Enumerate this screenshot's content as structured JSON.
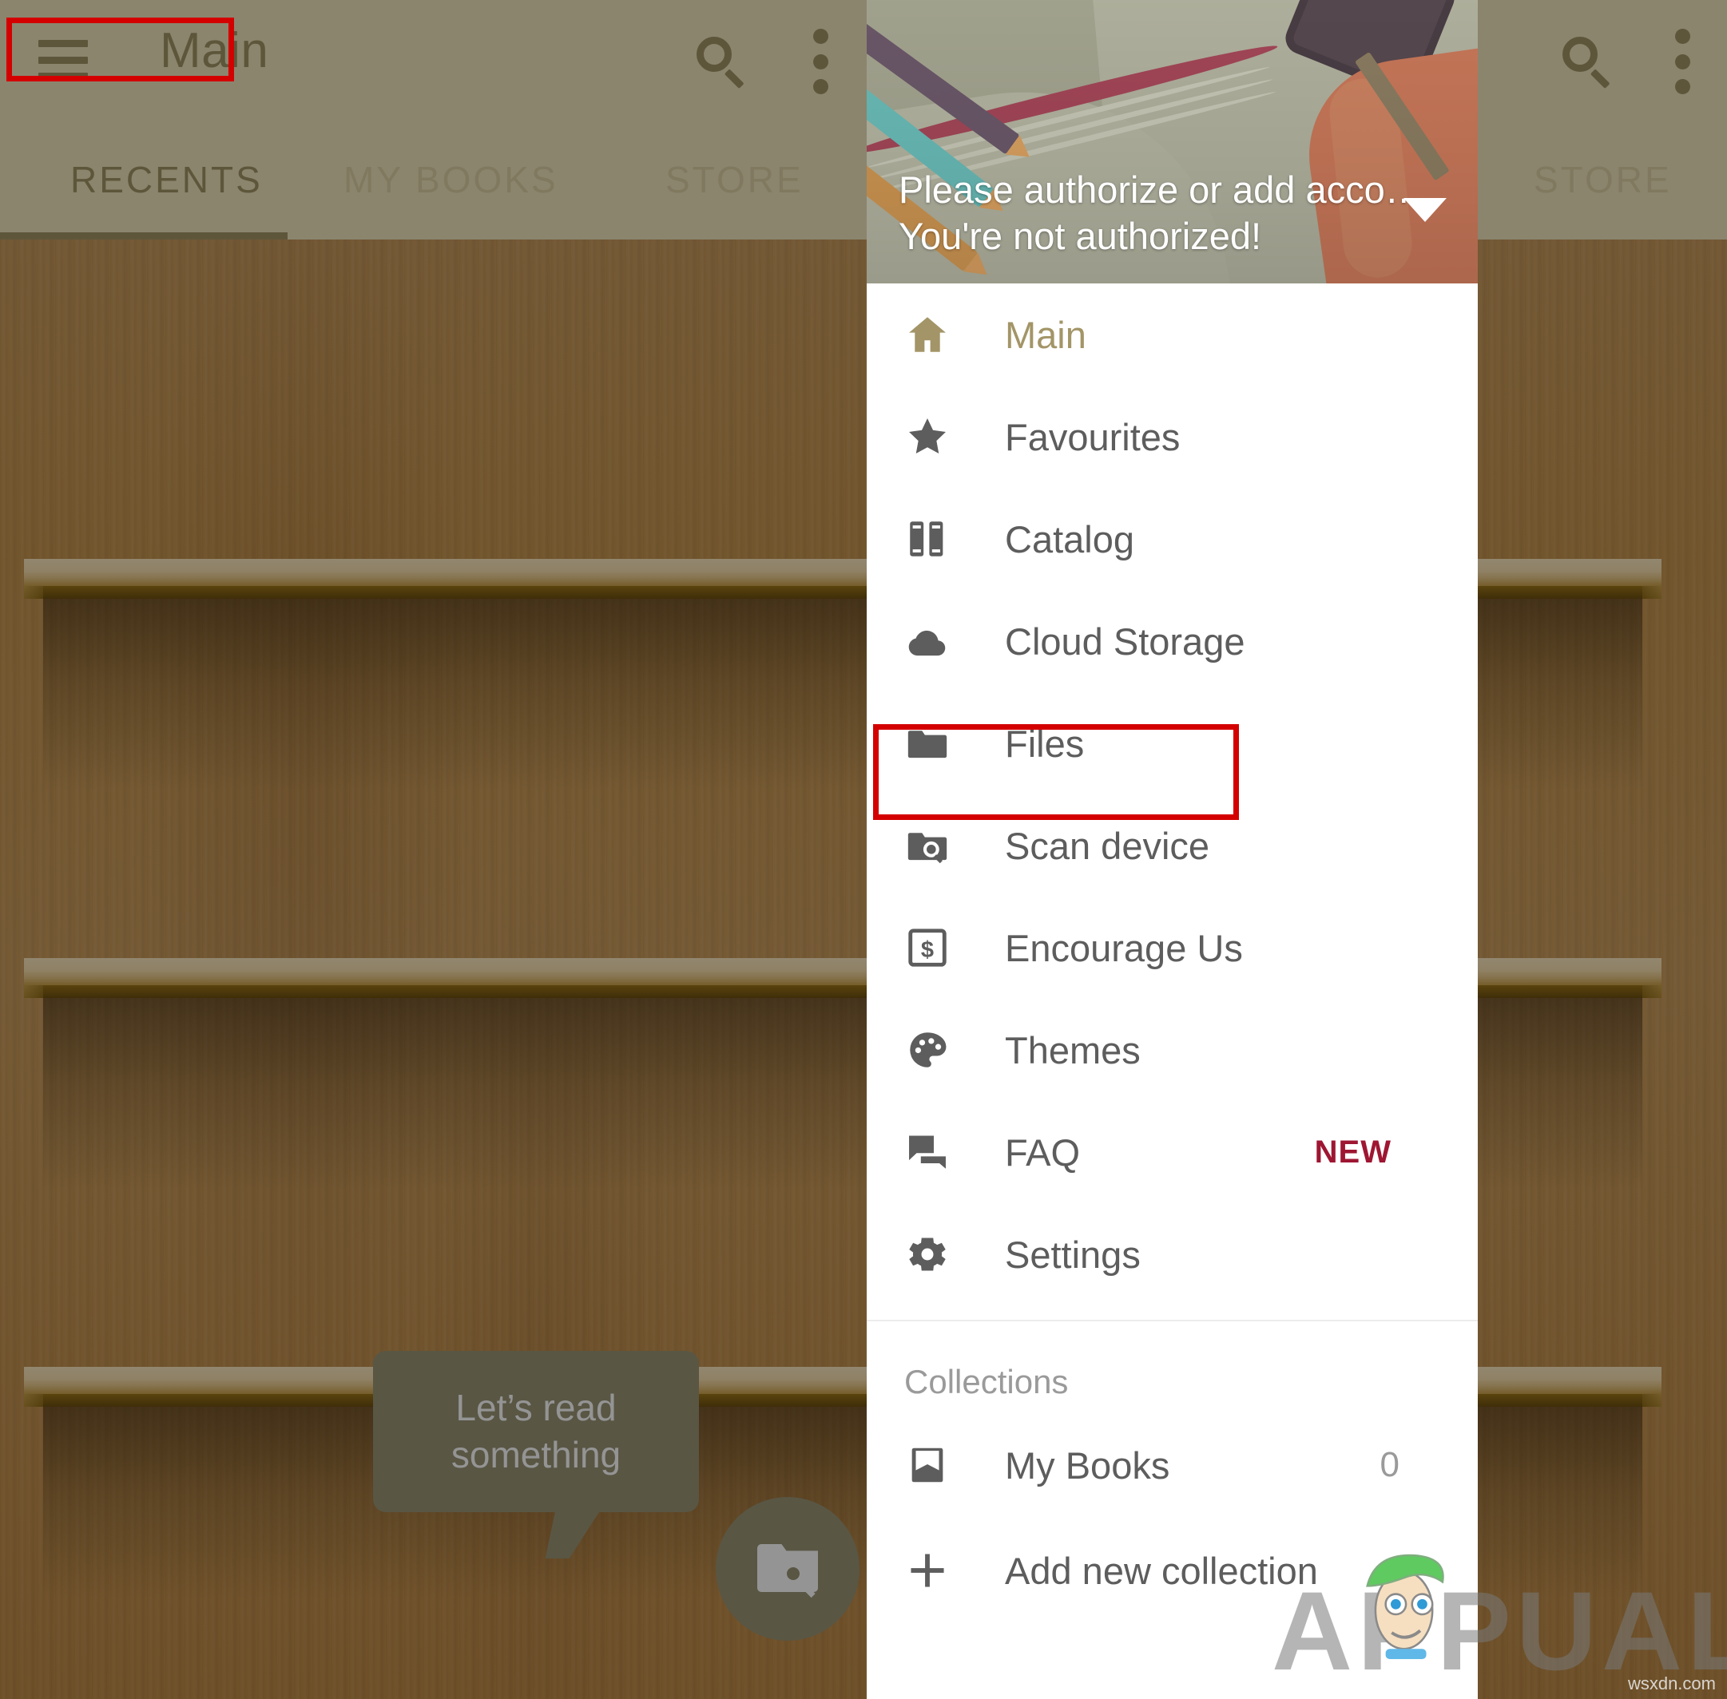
{
  "app": {
    "title": "Main",
    "search_icon": "search-icon",
    "overflow_icon": "more-vert-icon",
    "menu_icon": "hamburger-menu-icon"
  },
  "tabs": [
    {
      "label": "RECENTS",
      "active": true
    },
    {
      "label": "MY BOOKS",
      "active": false
    },
    {
      "label": "STORE",
      "active": false
    }
  ],
  "content": {
    "bubble_line1": "Let’s read",
    "bubble_line2": "something",
    "fab_icon": "folder-search-icon"
  },
  "drawer": {
    "header": {
      "account_line": "Please authorize or add acco…",
      "status_line": "You're not authorized!",
      "caret_icon": "chevron-down-icon"
    },
    "items": [
      {
        "label": "Main",
        "icon": "home-icon",
        "selected": true,
        "trailing": ""
      },
      {
        "label": "Favourites",
        "icon": "star-icon",
        "selected": false,
        "trailing": ""
      },
      {
        "label": "Catalog",
        "icon": "books-icon",
        "selected": false,
        "trailing": ""
      },
      {
        "label": "Cloud Storage",
        "icon": "cloud-icon",
        "selected": false,
        "trailing": ""
      },
      {
        "label": "Files",
        "icon": "folder-icon",
        "selected": false,
        "trailing": ""
      },
      {
        "label": "Scan device",
        "icon": "folder-search-icon",
        "selected": false,
        "trailing": ""
      },
      {
        "label": "Encourage Us",
        "icon": "money-icon",
        "selected": false,
        "trailing": ""
      },
      {
        "label": "Themes",
        "icon": "palette-icon",
        "selected": false,
        "trailing": ""
      },
      {
        "label": "FAQ",
        "icon": "chat-icon",
        "selected": false,
        "trailing": "NEW"
      },
      {
        "label": "Settings",
        "icon": "gear-icon",
        "selected": false,
        "trailing": ""
      }
    ],
    "collections": {
      "section_label": "Collections",
      "my_books_label": "My Books",
      "my_books_icon": "bookmark-icon",
      "my_books_count": "0",
      "add_label": "Add new collection",
      "add_icon": "plus-icon"
    }
  },
  "background_app": {
    "tab_store": "STORE",
    "search_icon": "search-icon",
    "overflow_icon": "more-vert-icon",
    "fab_icon": "folder-search-icon"
  },
  "watermark": {
    "text": "APPUALS",
    "url": "wsxdn.com"
  },
  "colors": {
    "appbar_bg": "#f0e5bd",
    "accent": "#a39567",
    "badge_new": "#9e1632",
    "annotation": "#d40000",
    "drawer_bg": "#ffffff",
    "bubble_bg": "#9a9475"
  }
}
